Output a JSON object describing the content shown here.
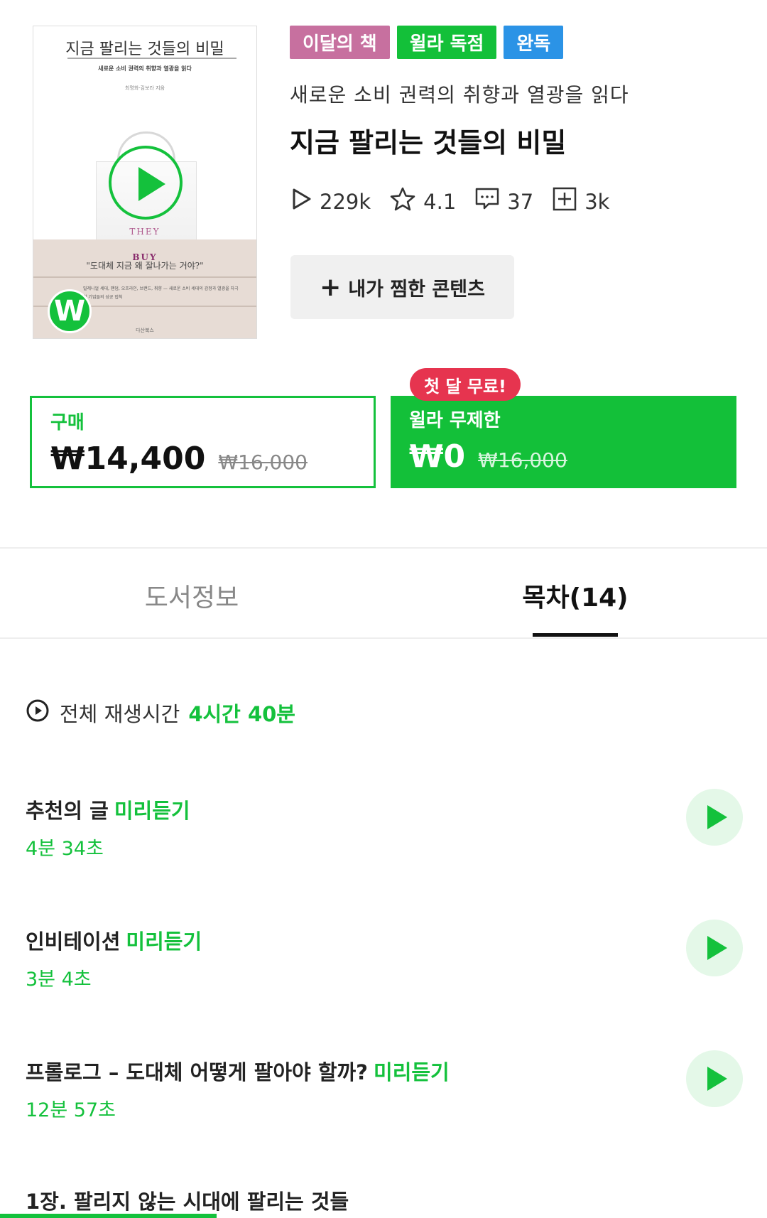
{
  "book": {
    "cover": {
      "title": "지금 팔리는 것들의 비밀",
      "subtitle": "새로운 소비 권력의 취향과 열광을 읽다",
      "author": "최명화·김보라 지음",
      "they": "THEY",
      "buy": "BUY",
      "quote": "\"도대체 지금 왜 잘나가는 거야?\"",
      "blurb": "밀레니얼 세대, 팬덤, 오프라인, 브랜드, 취향 — 새로운 소비 세대의 감정과 열광을 자극한 기업들의 성공 법칙",
      "publisher": "다산북스",
      "logo_letter": "W"
    },
    "badges": [
      "이달의 책",
      "윌라 독점",
      "완독"
    ],
    "subtitle": "새로운 소비 권력의 취향과 열광을 읽다",
    "title": "지금 팔리는 것들의 비밀",
    "stats": {
      "plays": "229k",
      "rating": "4.1",
      "comments": "37",
      "saves": "3k"
    },
    "wish_button": "내가 찜한 콘텐츠",
    "wish_plus": "+"
  },
  "pricing": {
    "buy": {
      "label": "구매",
      "price": "₩14,400",
      "original": "₩16,000"
    },
    "subscription": {
      "promo": "첫 달 무료!",
      "label": "윌라 무제한",
      "price": "₩0",
      "original": "₩16,000"
    }
  },
  "tabs": [
    {
      "label": "도서정보",
      "active": false
    },
    {
      "label": "목차(14)",
      "active": true
    }
  ],
  "contents": {
    "total_label": "전체 재생시간",
    "total_value": "4시간 40분",
    "chapters": [
      {
        "title": "추천의 글",
        "preview": "미리듣기",
        "duration": "4분 34초"
      },
      {
        "title": "인비테이션",
        "preview": "미리듣기",
        "duration": "3분 4초"
      },
      {
        "title": "프롤로그 – 도대체 어떻게 팔아야 할까?",
        "preview": "미리듣기",
        "duration": "12분 57초"
      },
      {
        "title": "1장. 팔리지 않는 시대에 팔리는 것들"
      }
    ]
  },
  "colors": {
    "accent": "#14c13c",
    "badge_month": "#c7709f",
    "badge_exclusive": "#13c039",
    "badge_complete": "#2b93e6",
    "promo": "#e6344f"
  },
  "icons": [
    "play-icon",
    "star-icon",
    "comment-icon",
    "add-box-icon",
    "play-circle-icon"
  ]
}
